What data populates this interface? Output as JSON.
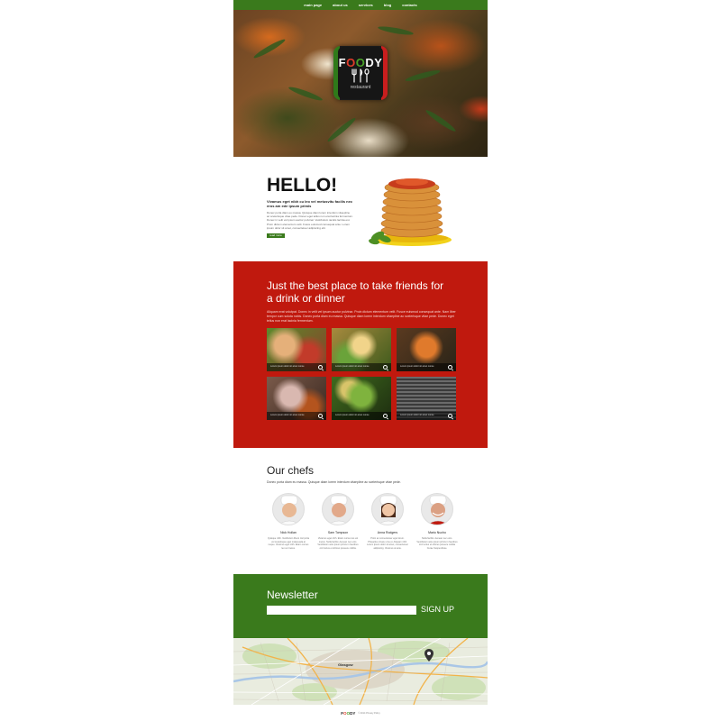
{
  "nav": {
    "items": [
      {
        "label": "main page"
      },
      {
        "label": "about us"
      },
      {
        "label": "services"
      },
      {
        "label": "blog"
      },
      {
        "label": "contacts"
      }
    ]
  },
  "hero": {
    "logo_f": "F",
    "logo_o1": "O",
    "logo_o2": "O",
    "logo_dy": "DY",
    "logo_sub": "restaurant"
  },
  "hello": {
    "title": "HELLO!",
    "subtitle": "Vivamus eget nibh cu leo vel metusvitu facilis nec eros am ede ipsum primis",
    "body": "Donec porta diam eu massa. Quisque diam lorem interdum vitaepline ac scelerisque vitae pede. Donec eget tellus non erat lacinia fermentum. Donec in velit vel ipsum auctor pulvinar. Vestibulum iaculis lacinia est. Proin dictum elementum velit. Fusce euismod consequat ante. Lorem ipsum dolor sit amet, consectetuer adipiscing elit.",
    "more_label": "read more"
  },
  "red": {
    "title": "Just the best place to take friends for a drink or dinner",
    "text": "Aliquam erat volutpat. Donec in velit vel ipsum auctor pulvinar. Proin dictum elementum velit. Fusce euismod consequat ante. Nam liber tempor cum soluta nobis. Donec porta diam eu massa. Quisque diam lorem interdum vitaepline ac scelerisque vitae pede. Donec eget tellus non erat lacinia fermentum.",
    "gallery": [
      {
        "caption": "Lorem ipsum dolor sit amet conse"
      },
      {
        "caption": "Lorem ipsum dolor sit amet conse"
      },
      {
        "caption": "Lorem ipsum dolor sit amet conse"
      },
      {
        "caption": "Lorem ipsum dolor sit amet conse"
      },
      {
        "caption": "Lorem ipsum dolor sit amet conse"
      },
      {
        "caption": "Lorem ipsum dolor sit amet conse"
      }
    ]
  },
  "chefs": {
    "title": "Our chefs",
    "intro": "Donec porta diam eu massa. Quisque diam lorem interdum vitaepline ac scelerisque vitae pede.",
    "list": [
      {
        "name": "Nick Hollan",
        "desc": "Quisque nibh. Vestibulum libero nisl porta vel scelerisque eget malesuada at neque. Vivamus eget nibh. Etiam cursus leo vel metus."
      },
      {
        "name": "Sam Tompson",
        "desc": "Vivamus eget nibh. Etiam cursus leo vel metus. Nulla facilisi. Aenean nec eros. Vestibulum ante ipsum primis in faucibus orci luctus et ultrices posuere cubilia."
      },
      {
        "name": "Anna Rodgers",
        "desc": "Proin ac consectetuer eget lorem. Phasellus ornare urna ut. Aliquam nibh. Lorem ipsum dolor sit amet, consectetuer adipiscing. Vivamus at ante."
      },
      {
        "name": "Mario Nucho",
        "desc": "Nulla facilisi. Aenean nec eros. Vestibulum ante ipsum primis in faucibus orci luctus et ultrices posuere cubilia Curae Suspendisse."
      }
    ]
  },
  "newsletter": {
    "title": "Newsletter",
    "input_value": "",
    "input_placeholder": "",
    "signup_label": "SIGN UP"
  },
  "map": {
    "city_label": "Glasgow"
  },
  "footer": {
    "logo_f": "F",
    "logo_o1": "O",
    "logo_o2": "O",
    "logo_dy": "DY",
    "text": "© 2014 Privacy Policy"
  },
  "colors": {
    "green": "#3a7a1c",
    "red": "#c0190e",
    "dark": "#161616"
  }
}
